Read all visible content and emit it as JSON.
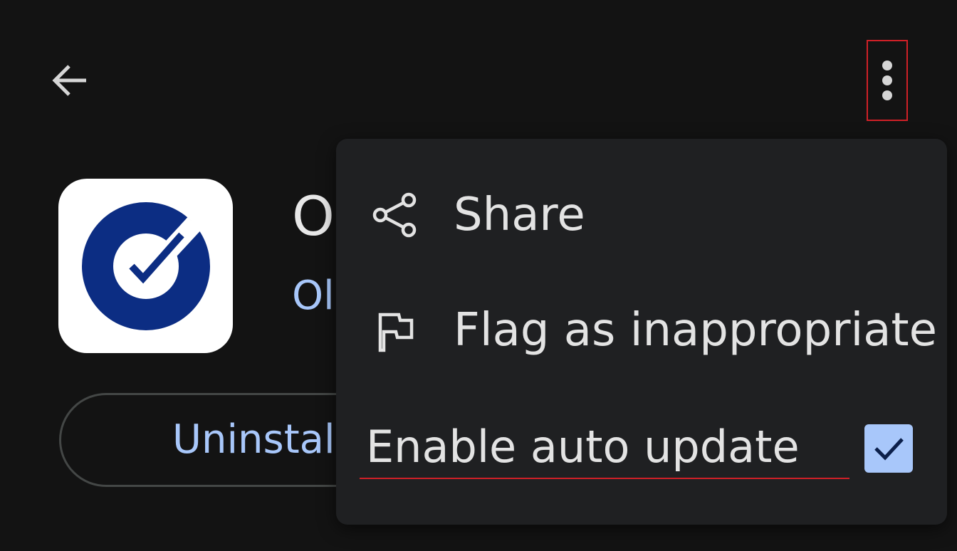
{
  "top_bar": {
    "back_icon": "arrow-left-icon",
    "more_icon": "more-vert-icon"
  },
  "app": {
    "title": "O",
    "developer": "Ol",
    "uninstall_label": "Uninstal",
    "icon": "app-logo-check-circle",
    "logo_color": "#0c2d83"
  },
  "menu": {
    "items": [
      {
        "label": "Share",
        "icon": "share-icon"
      },
      {
        "label": "Flag as inappropriate",
        "icon": "flag-icon"
      }
    ],
    "auto_update": {
      "label": "Enable auto update",
      "checked": true
    }
  },
  "colors": {
    "background": "#131313",
    "menu_background": "#1f2022",
    "accent": "#a8c7fa",
    "text": "#e3e3e3",
    "highlight": "#d02027"
  }
}
